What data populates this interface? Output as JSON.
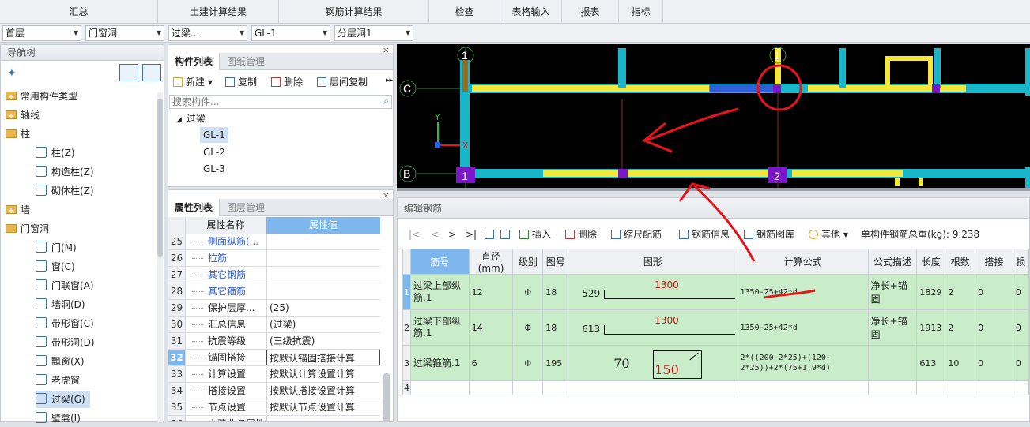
{
  "top_tabs": [
    "汇总",
    "土建计算结果",
    "钢筋计算结果",
    "检查",
    "表格输入",
    "报表",
    "指标"
  ],
  "combos": {
    "floor": "首层",
    "category": "门窗洞",
    "type": "过梁...",
    "element": "GL-1",
    "layer": "分层洞1"
  },
  "nav": {
    "title": "导航树",
    "items": [
      {
        "label": "常用构件类型",
        "kind": "folder"
      },
      {
        "label": "轴线",
        "kind": "folder"
      },
      {
        "label": "柱",
        "kind": "folder-open"
      },
      {
        "label": "柱(Z)",
        "kind": "child"
      },
      {
        "label": "构造柱(Z)",
        "kind": "child"
      },
      {
        "label": "砌体柱(Z)",
        "kind": "child"
      },
      {
        "label": "墙",
        "kind": "folder"
      },
      {
        "label": "门窗洞",
        "kind": "folder-open"
      },
      {
        "label": "门(M)",
        "kind": "child"
      },
      {
        "label": "窗(C)",
        "kind": "child"
      },
      {
        "label": "门联窗(A)",
        "kind": "child"
      },
      {
        "label": "墙洞(D)",
        "kind": "child"
      },
      {
        "label": "带形窗(C)",
        "kind": "child"
      },
      {
        "label": "带形洞(D)",
        "kind": "child"
      },
      {
        "label": "飘窗(X)",
        "kind": "child"
      },
      {
        "label": "老虎窗",
        "kind": "child"
      },
      {
        "label": "过梁(G)",
        "kind": "child-selected"
      },
      {
        "label": "壁龛(I)",
        "kind": "child"
      }
    ]
  },
  "component_list": {
    "tab_active": "构件列表",
    "tab_inactive": "图纸管理",
    "toolbar": {
      "new": "新建",
      "copy": "复制",
      "delete": "删除",
      "floor_copy": "层间复制"
    },
    "search_placeholder": "搜索构件...",
    "root": "过梁",
    "items": [
      "GL-1",
      "GL-2",
      "GL-3"
    ]
  },
  "property_list": {
    "tab_active": "属性列表",
    "tab_inactive": "图层管理",
    "header_name": "属性名称",
    "header_value": "属性值",
    "rows": [
      {
        "n": "25",
        "name": "侧面纵筋(...",
        "value": "",
        "blue": true
      },
      {
        "n": "26",
        "name": "拉筋",
        "value": "",
        "blue": true
      },
      {
        "n": "27",
        "name": "其它钢筋",
        "value": "",
        "blue": true
      },
      {
        "n": "28",
        "name": "其它箍筋",
        "value": "",
        "blue": true
      },
      {
        "n": "29",
        "name": "保护层厚...",
        "value": "(25)",
        "blue": false
      },
      {
        "n": "30",
        "name": "汇总信息",
        "value": "(过梁)",
        "blue": false
      },
      {
        "n": "31",
        "name": "抗震等级",
        "value": "(三级抗震)",
        "blue": false
      },
      {
        "n": "32",
        "name": "锚固搭接",
        "value": "按默认锚固搭接计算",
        "blue": false
      },
      {
        "n": "33",
        "name": "计算设置",
        "value": "按默认计算设置计算",
        "blue": false
      },
      {
        "n": "34",
        "name": "搭接设置",
        "value": "按默认搭接设置计算",
        "blue": false
      },
      {
        "n": "35",
        "name": "节点设置",
        "value": "按默认节点设置计算",
        "blue": false
      },
      {
        "n": "36",
        "name": "土建业务属性",
        "value": "",
        "blue": false
      }
    ]
  },
  "drawing": {
    "axis_labels": [
      "1",
      "1",
      "2",
      "C",
      "B"
    ],
    "axis_x": "X",
    "axis_y": "Y"
  },
  "rebar_editor": {
    "title": "编辑钢筋",
    "nav_buttons": [
      "|<",
      "<",
      ">",
      ">|"
    ],
    "toolbar": {
      "insert": "插入",
      "delete": "删除",
      "scale": "缩尺配筋",
      "info": "钢筋信息",
      "library": "钢筋图库",
      "other": "其他"
    },
    "total_weight_label": "单构件钢筋总重(kg):",
    "total_weight": "9.238",
    "headers": [
      "筋号",
      "直径(mm)",
      "级别",
      "图号",
      "图形",
      "计算公式",
      "公式描述",
      "长度",
      "根数",
      "搭接",
      "损"
    ],
    "rows": [
      {
        "idx": "1",
        "name": "过梁上部纵筋.1",
        "dia": "12",
        "grade": "Φ",
        "fig": "18",
        "shape_left": "529",
        "shape_mid": "1300",
        "formula": "1350-25+42*d",
        "desc": "净长+锚固",
        "len": "1829",
        "count": "2",
        "lap": "0",
        "loss": "0"
      },
      {
        "idx": "2",
        "name": "过梁下部纵筋.1",
        "dia": "14",
        "grade": "Φ",
        "fig": "18",
        "shape_left": "613",
        "shape_mid": "1300",
        "formula": "1350-25+42*d",
        "desc": "净长+锚固",
        "len": "1913",
        "count": "2",
        "lap": "0",
        "loss": "0"
      },
      {
        "idx": "3",
        "name": "过梁箍筋.1",
        "dia": "6",
        "grade": "Φ",
        "fig": "195",
        "shape_left": "70",
        "shape_mid": "150",
        "formula": "2*((200-2*25)+(120-2*25))+2*(75+1.9*d)",
        "desc": "",
        "len": "613",
        "count": "10",
        "lap": "0",
        "loss": "0"
      },
      {
        "idx": "4",
        "name": "",
        "dia": "",
        "grade": "",
        "fig": "",
        "shape_left": "",
        "shape_mid": "",
        "formula": "",
        "desc": "",
        "len": "",
        "count": "",
        "lap": "",
        "loss": ""
      }
    ]
  },
  "colors": {
    "cyan": "#18b6c8",
    "yellow": "#f5e63a",
    "purple": "#7a18c8",
    "annotation_red": "#e8141a",
    "selected_row": "#c9ecc9"
  }
}
